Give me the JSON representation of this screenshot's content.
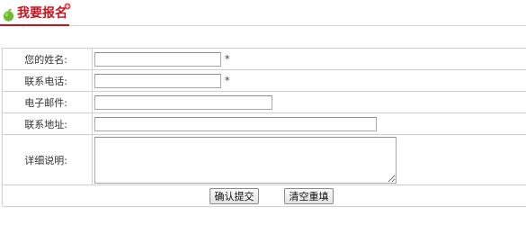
{
  "header": {
    "title": "我要报名",
    "icon": "apple-icon",
    "badge_icon": "plus-badge-icon",
    "accent_color": "#c8131f"
  },
  "form": {
    "fields": [
      {
        "label": "您的姓名:",
        "value": "",
        "required_mark": "*"
      },
      {
        "label": "联系电话:",
        "value": "",
        "required_mark": "*"
      },
      {
        "label": "电子邮件:",
        "value": ""
      },
      {
        "label": "联系地址:",
        "value": ""
      },
      {
        "label": "详细说明:",
        "value": ""
      }
    ],
    "submit_label": "确认提交",
    "reset_label": "清空重填"
  }
}
